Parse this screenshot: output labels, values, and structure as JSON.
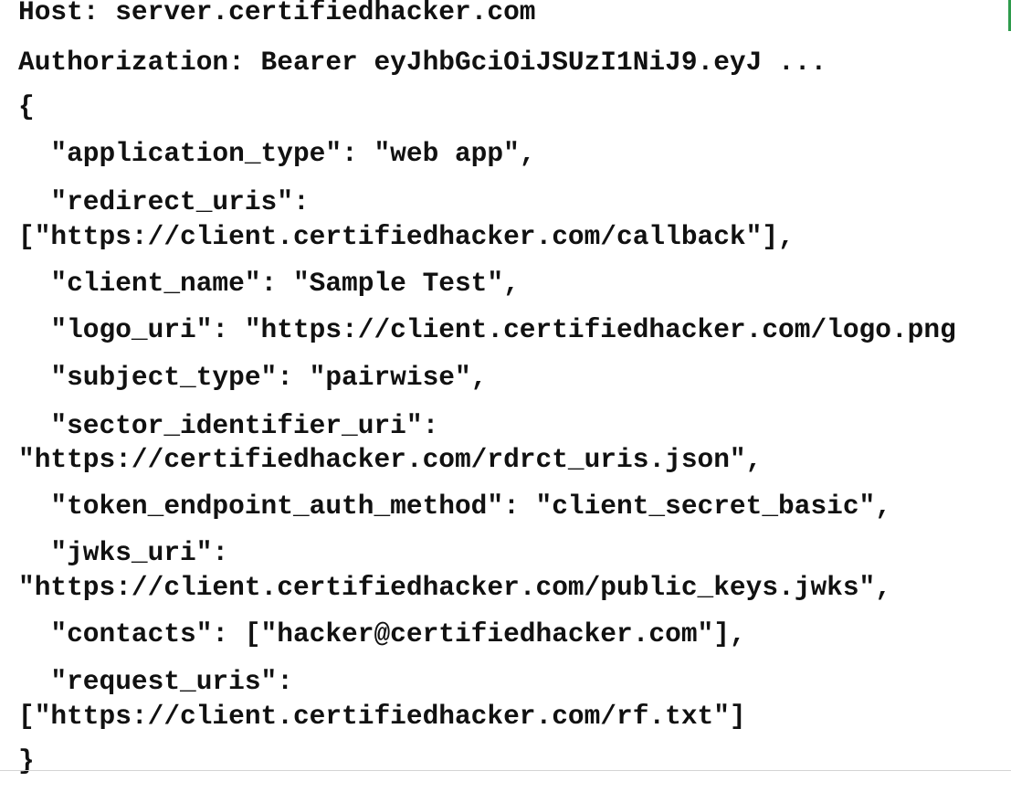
{
  "request": {
    "host": "Host: server.certifiedhacker.com",
    "authorization": "Authorization: Bearer eyJhbGciOiJSUzI1NiJ9.eyJ ..."
  },
  "body": {
    "open": "{",
    "application_type": "  \"application_type\": \"web app\",",
    "redirect_uris_key": "  \"redirect_uris\":",
    "redirect_uris_value": "[\"https://client.certifiedhacker.com/callback\"],",
    "client_name": "  \"client_name\": \"Sample Test\",",
    "logo_uri": "  \"logo_uri\": \"https://client.certifiedhacker.com/logo.png",
    "subject_type": "  \"subject_type\": \"pairwise\",",
    "sector_identifier_uri_key": "  \"sector_identifier_uri\":",
    "sector_identifier_uri_value": "\"https://certifiedhacker.com/rdrct_uris.json\",",
    "token_endpoint_auth_method": "  \"token_endpoint_auth_method\": \"client_secret_basic\",",
    "jwks_uri_key": "  \"jwks_uri\":",
    "jwks_uri_value": "\"https://client.certifiedhacker.com/public_keys.jwks\",",
    "contacts": "  \"contacts\": [\"hacker@certifiedhacker.com\"],",
    "request_uris_key": "  \"request_uris\":",
    "request_uris_value": "[\"https://client.certifiedhacker.com/rf.txt\"]",
    "close": "}"
  },
  "colors": {
    "text": "#111111",
    "background": "#ffffff",
    "edge_accent": "#2e9b4c"
  }
}
